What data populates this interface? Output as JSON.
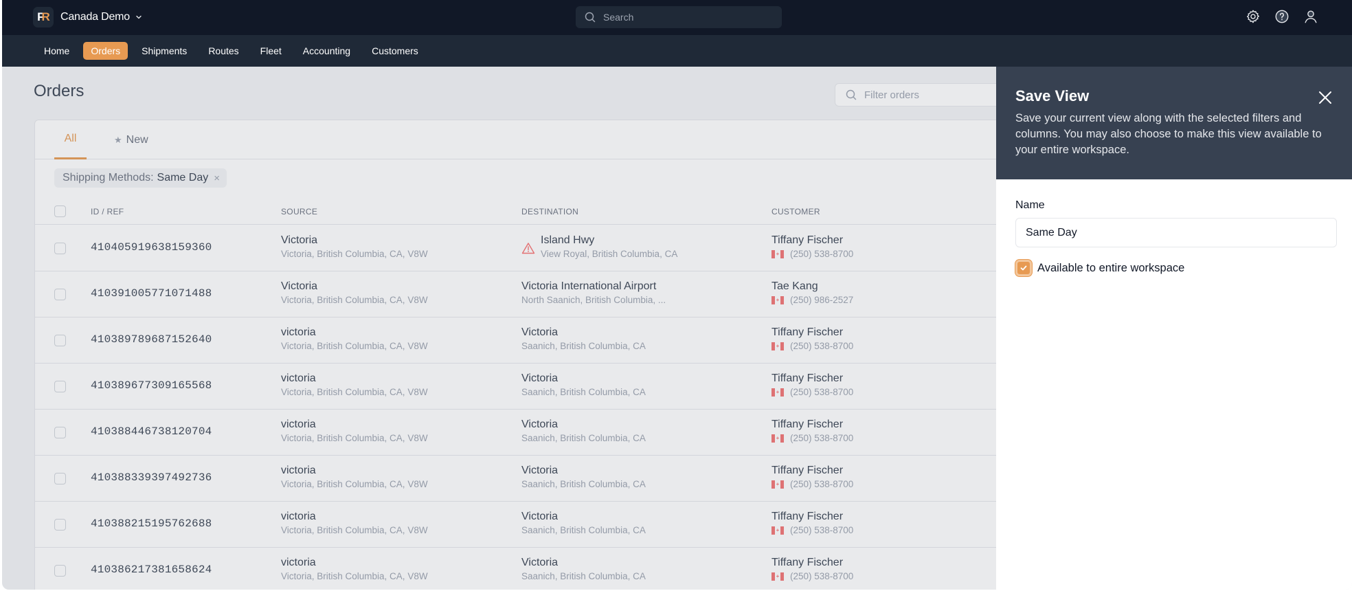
{
  "app": {
    "logo_text": [
      "F",
      "R"
    ],
    "workspace": "Canada Demo",
    "search_placeholder": "Search",
    "icons": [
      "gear-icon",
      "help-icon",
      "user-icon"
    ]
  },
  "nav": {
    "items": [
      {
        "label": "Home",
        "active": false
      },
      {
        "label": "Orders",
        "active": true
      },
      {
        "label": "Shipments",
        "active": false
      },
      {
        "label": "Routes",
        "active": false
      },
      {
        "label": "Fleet",
        "active": false
      },
      {
        "label": "Accounting",
        "active": false
      },
      {
        "label": "Customers",
        "active": false
      }
    ]
  },
  "page": {
    "title": "Orders",
    "filter_placeholder": "Filter orders",
    "tabs": [
      {
        "label": "All",
        "active": true
      },
      {
        "label": "New",
        "icon": "star-icon",
        "active": false
      }
    ],
    "filter_chip": {
      "key": "Shipping Methods:",
      "value": "Same Day",
      "remove": "×"
    }
  },
  "table": {
    "columns": [
      "ID / REF",
      "SOURCE",
      "DESTINATION",
      "CUSTOMER"
    ],
    "rows": [
      {
        "id": "410405919638159360",
        "source": {
          "name": "Victoria",
          "address": "Victoria, British Columbia, CA, V8W"
        },
        "destination": {
          "name": "Island Hwy",
          "address": "View Royal, British Columbia, CA",
          "warning": true
        },
        "customer": {
          "name": "Tiffany Fischer",
          "phone": "(250) 538-8700"
        }
      },
      {
        "id": "410391005771071488",
        "source": {
          "name": "Victoria",
          "address": "Victoria, British Columbia, CA, V8W"
        },
        "destination": {
          "name": "Victoria International Airport",
          "address": "North Saanich, British Columbia, ...",
          "warning": false
        },
        "customer": {
          "name": "Tae Kang",
          "phone": "(250) 986-2527"
        }
      },
      {
        "id": "410389789687152640",
        "source": {
          "name": "victoria",
          "address": "Victoria, British Columbia, CA, V8W"
        },
        "destination": {
          "name": "Victoria",
          "address": "Saanich, British Columbia, CA",
          "warning": false
        },
        "customer": {
          "name": "Tiffany Fischer",
          "phone": "(250) 538-8700"
        }
      },
      {
        "id": "410389677309165568",
        "source": {
          "name": "victoria",
          "address": "Victoria, British Columbia, CA, V8W"
        },
        "destination": {
          "name": "Victoria",
          "address": "Saanich, British Columbia, CA",
          "warning": false
        },
        "customer": {
          "name": "Tiffany Fischer",
          "phone": "(250) 538-8700"
        }
      },
      {
        "id": "410388446738120704",
        "source": {
          "name": "victoria",
          "address": "Victoria, British Columbia, CA, V8W"
        },
        "destination": {
          "name": "Victoria",
          "address": "Saanich, British Columbia, CA",
          "warning": false
        },
        "customer": {
          "name": "Tiffany Fischer",
          "phone": "(250) 538-8700"
        }
      },
      {
        "id": "410388339397492736",
        "source": {
          "name": "victoria",
          "address": "Victoria, British Columbia, CA, V8W"
        },
        "destination": {
          "name": "Victoria",
          "address": "Saanich, British Columbia, CA",
          "warning": false
        },
        "customer": {
          "name": "Tiffany Fischer",
          "phone": "(250) 538-8700"
        }
      },
      {
        "id": "410388215195762688",
        "source": {
          "name": "victoria",
          "address": "Victoria, British Columbia, CA, V8W"
        },
        "destination": {
          "name": "Victoria",
          "address": "Saanich, British Columbia, CA",
          "warning": false
        },
        "customer": {
          "name": "Tiffany Fischer",
          "phone": "(250) 538-8700"
        }
      },
      {
        "id": "410386217381658624",
        "source": {
          "name": "victoria",
          "address": "Victoria, British Columbia, CA, V8W"
        },
        "destination": {
          "name": "Victoria",
          "address": "Saanich, British Columbia, CA",
          "warning": false
        },
        "customer": {
          "name": "Tiffany Fischer",
          "phone": "(250) 538-8700"
        }
      }
    ]
  },
  "panel": {
    "title": "Save View",
    "description": "Save your current view along with the selected filters and columns. You may also choose to make this view available to your entire workspace.",
    "name_label": "Name",
    "name_value": "Same Day",
    "checkbox_label": "Available to entire workspace",
    "checkbox_checked": true
  },
  "colors": {
    "accent": "#e79a52",
    "topbar": "#111827",
    "navbar": "#1f2937",
    "panel_header": "#374151",
    "warning": "#f87171",
    "flag_red": "#ef4444"
  }
}
